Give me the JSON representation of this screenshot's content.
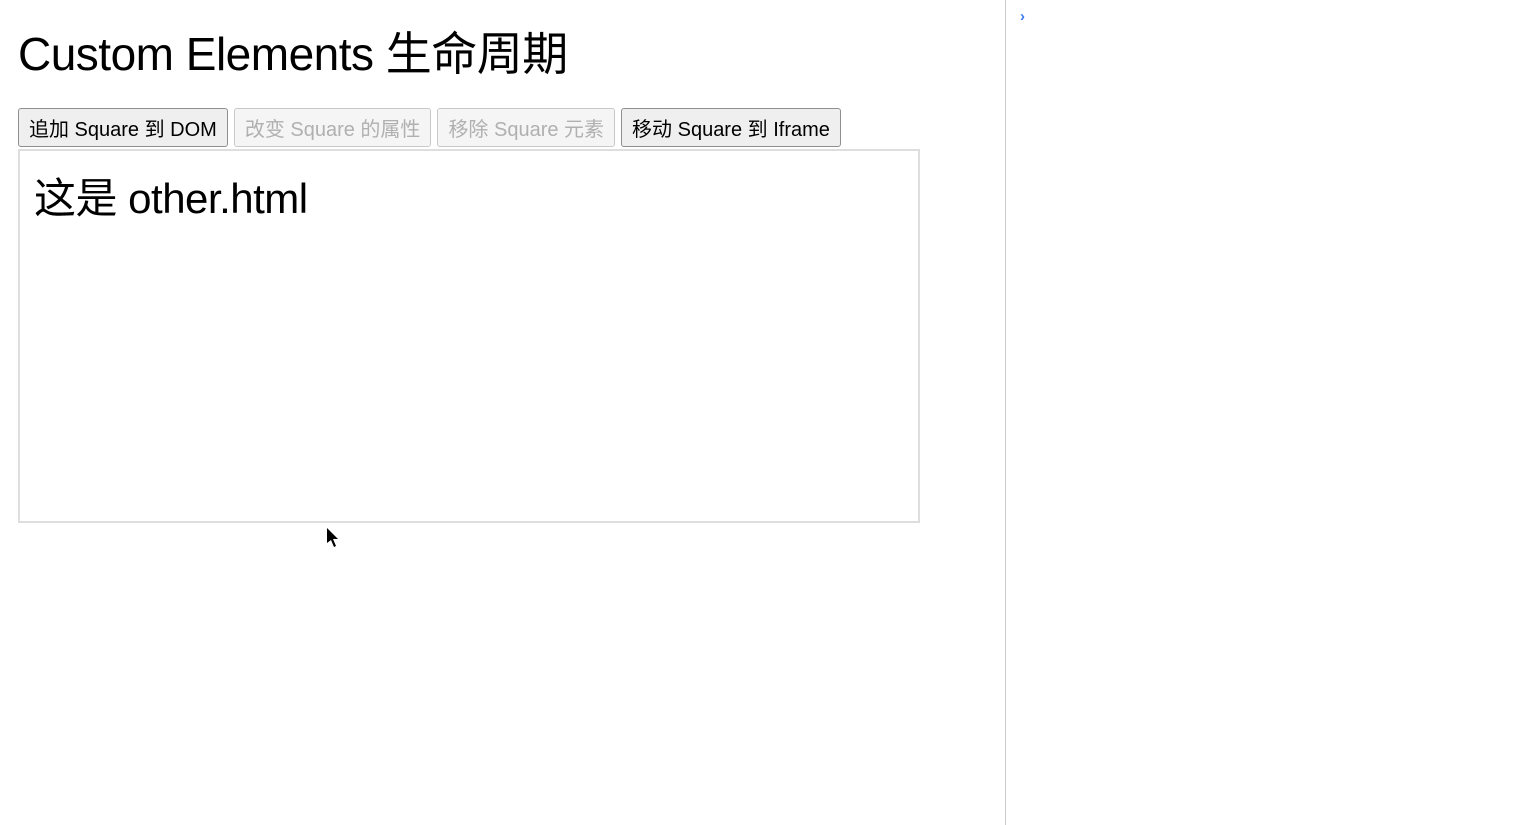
{
  "page": {
    "title": "Custom Elements 生命周期"
  },
  "buttons": {
    "add": {
      "label": "追加 Square 到 DOM",
      "disabled": false
    },
    "change": {
      "label": "改变 Square 的属性",
      "disabled": true
    },
    "remove": {
      "label": "移除 Square 元素",
      "disabled": true
    },
    "move": {
      "label": "移动 Square 到 Iframe",
      "disabled": false
    }
  },
  "iframe": {
    "heading": "这是 other.html"
  },
  "console": {
    "prompt": "›"
  }
}
